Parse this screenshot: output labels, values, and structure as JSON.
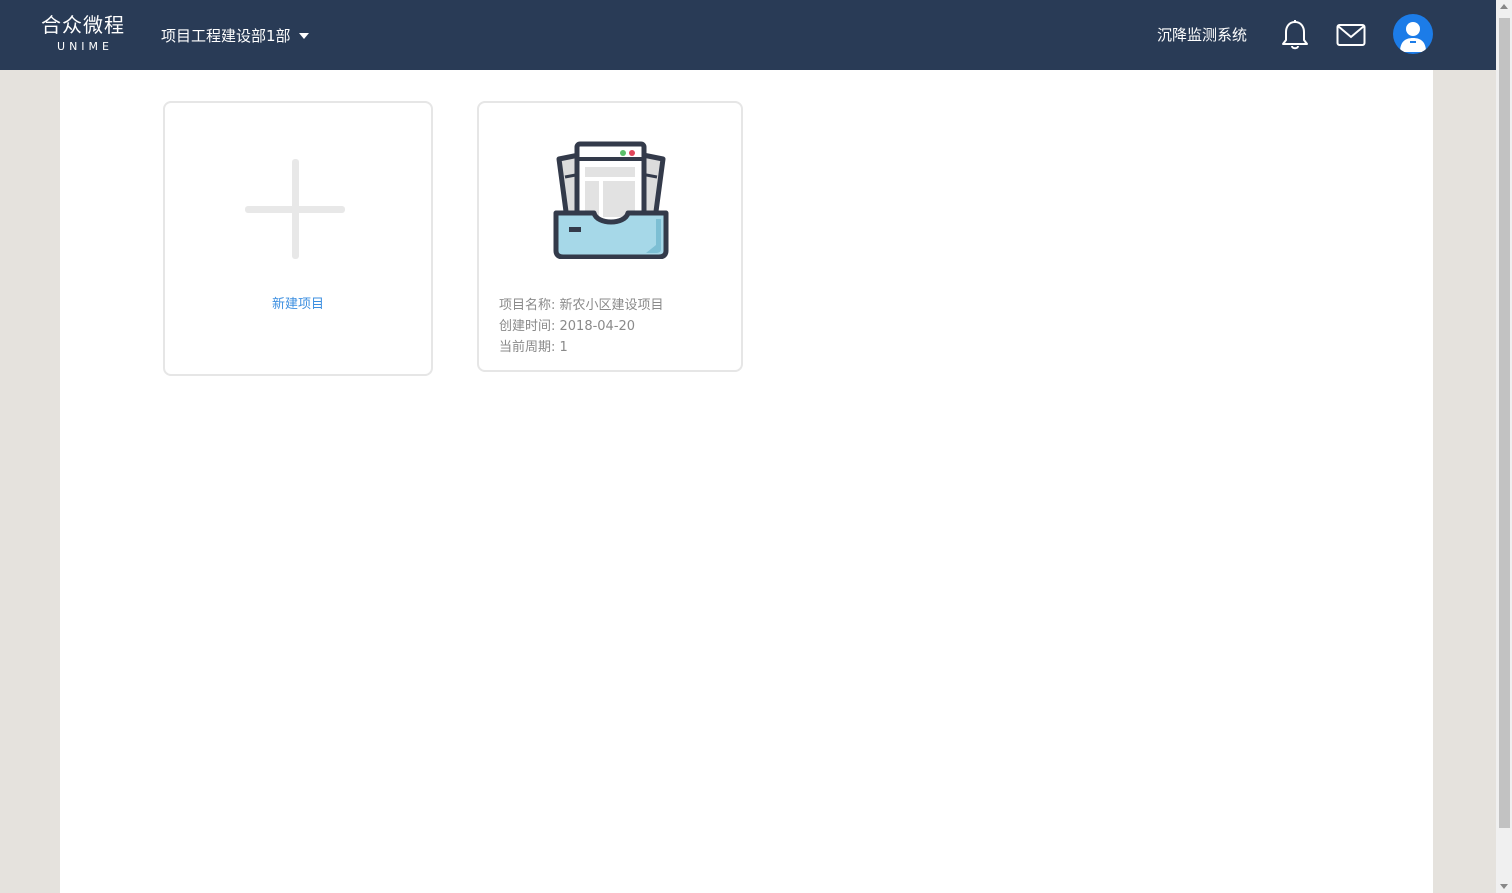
{
  "header": {
    "logo_cn": "合众微程",
    "logo_en": "UNIME",
    "dept_selector": "项目工程建设部1部",
    "system_link": "沉降监测系统",
    "colors": {
      "bar": "#293b56",
      "avatar": "#1c7ce8"
    },
    "icons": [
      "caret-down-icon",
      "bell-icon",
      "mail-icon",
      "user-avatar-icon"
    ]
  },
  "new_project_card": {
    "label": "新建项目",
    "icon": "plus-icon",
    "label_color": "#3d8fe0"
  },
  "project_card": {
    "icon": "project-box-icon",
    "name_line": "项目名称: 新农小区建设项目",
    "created_line": "创建时间: 2018-04-20",
    "period_line": "当前周期: 1"
  }
}
